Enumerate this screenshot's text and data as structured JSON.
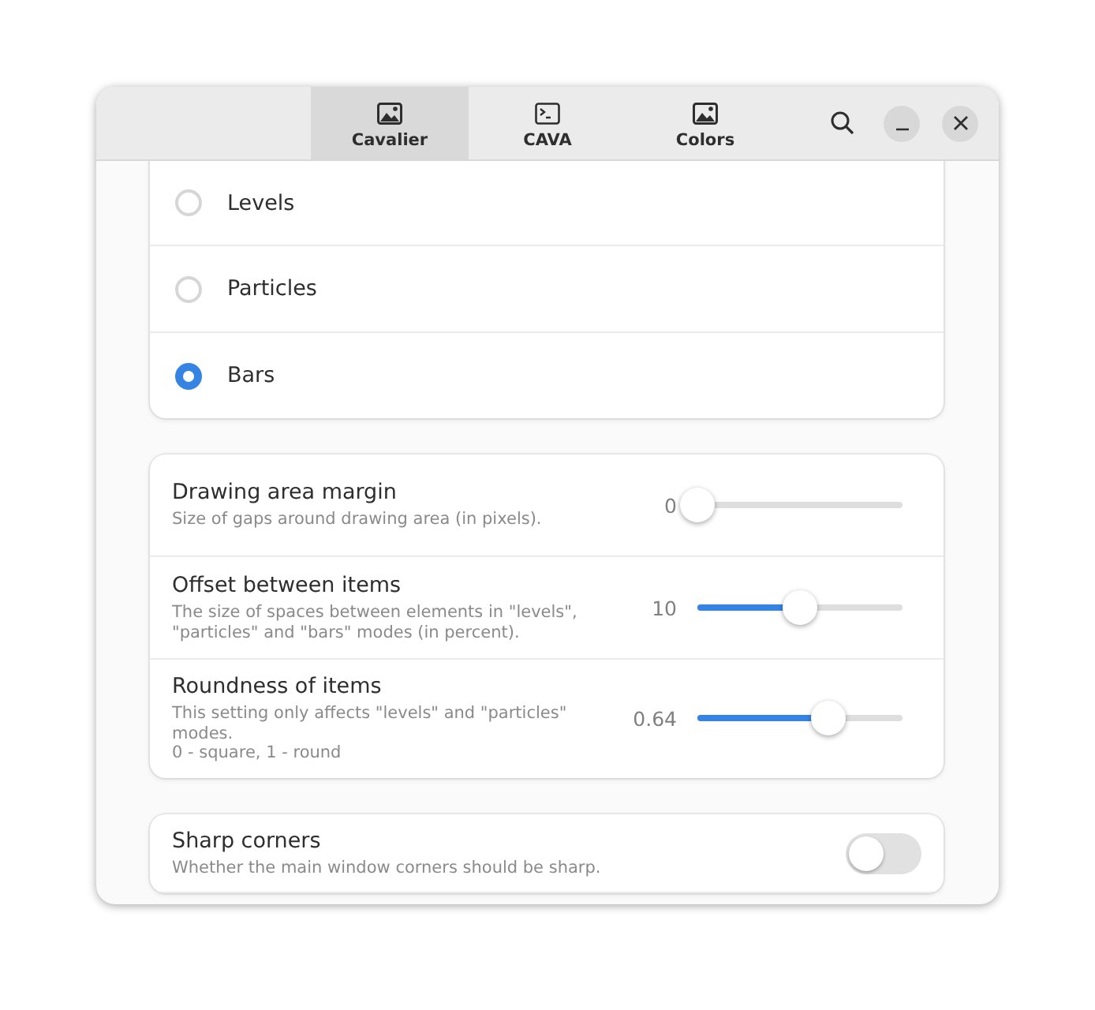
{
  "tabs": [
    {
      "label": "Cavalier",
      "kind": "image",
      "selected": true
    },
    {
      "label": "CAVA",
      "kind": "terminal",
      "selected": false
    },
    {
      "label": "Colors",
      "kind": "image",
      "selected": false
    }
  ],
  "modes": [
    {
      "label": "Levels",
      "selected": false
    },
    {
      "label": "Particles",
      "selected": false
    },
    {
      "label": "Bars",
      "selected": true
    }
  ],
  "sliders": [
    {
      "title": "Drawing area margin",
      "description": "Size of gaps around drawing area (in pixels).",
      "reading": "0",
      "level": 0
    },
    {
      "title": "Offset between items",
      "description": "The size of spaces between elements in \"levels\", \"particles\" and \"bars\" modes (in percent).",
      "reading": "10",
      "level": 0.5
    },
    {
      "title": "Roundness of items",
      "description": "This setting only affects \"levels\" and \"particles\" modes.\n0 - square, 1 - round",
      "reading": "0.64",
      "level": 0.64
    }
  ],
  "switches": [
    {
      "title": "Sharp corners",
      "description": "Whether the main window corners should be sharp.",
      "on": false
    }
  ]
}
